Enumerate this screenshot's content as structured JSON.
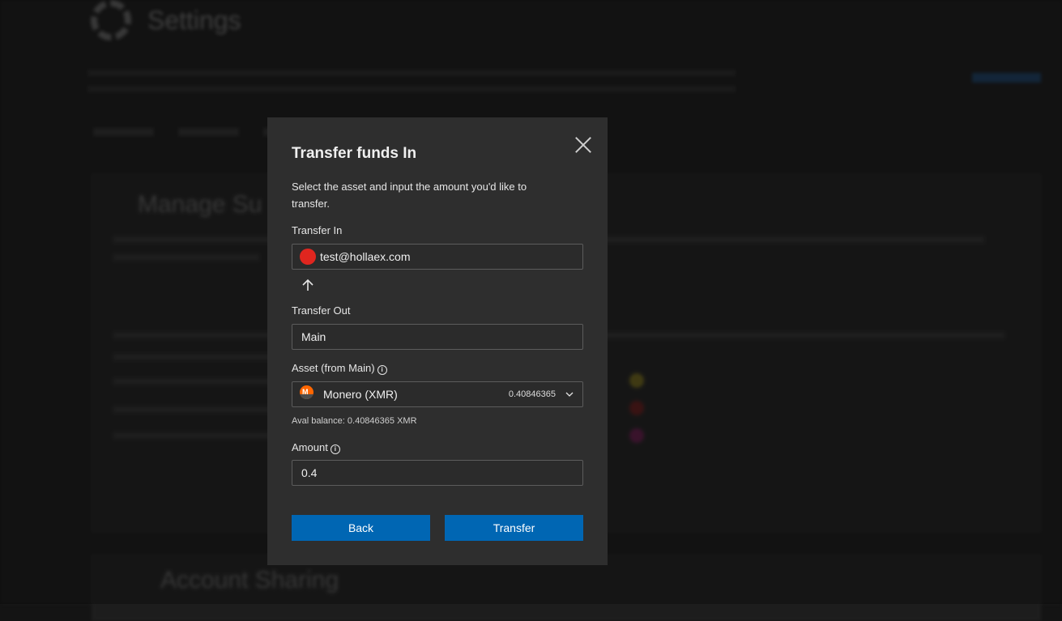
{
  "background": {
    "page_title": "Settings",
    "card_title": "Manage Su",
    "card2_title": "Account Sharing"
  },
  "modal": {
    "title": "Transfer funds In",
    "description": "Select the asset and input the amount you'd like to transfer.",
    "transfer_in": {
      "label": "Transfer In",
      "value": "test@hollaex.com"
    },
    "transfer_out": {
      "label": "Transfer Out",
      "value": "Main"
    },
    "asset": {
      "label": "Asset (from Main)",
      "name": "Monero (XMR)",
      "balance": "0.40846365",
      "available_text": "Aval balance: 0.40846365 XMR"
    },
    "amount": {
      "label": "Amount",
      "value": "0.4"
    },
    "buttons": {
      "back": "Back",
      "transfer": "Transfer"
    },
    "icons": {
      "close": "close-icon",
      "arrow": "arrow-up-icon",
      "info": "info-icon",
      "coin": "monero-icon",
      "dropdown": "chevron-down-icon"
    },
    "colors": {
      "primary_button": "#0066b3",
      "avatar": "#e0261f",
      "monero": "#ff6600"
    }
  }
}
